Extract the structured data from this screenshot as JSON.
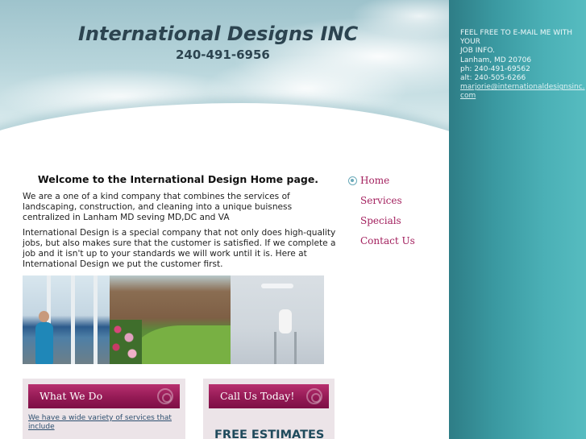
{
  "header": {
    "title": "International Designs INC",
    "phone": "240-491-6956"
  },
  "contact": {
    "line1": "FEEL FREE TO E-MAIL ME WITH YOUR",
    "line2": "JOB INFO.",
    "address": "Lanham, MD 20706",
    "phone": "ph: 240-491-69562",
    "alt": "alt: 240-505-6266",
    "email": "marjorie@internationaldesignsinc.com"
  },
  "nav": {
    "items": [
      {
        "label": "Home"
      },
      {
        "label": "Services"
      },
      {
        "label": "Specials"
      },
      {
        "label": "Contact Us"
      }
    ]
  },
  "main": {
    "welcome": "Welcome to the International Design Home page.",
    "paragraph1": "We are a one of a kind company that combines the services of landscaping, construction, and cleaning into a unique buisness centralized in Lanham MD seving MD,DC and VA",
    "paragraph2": "International Design is a special company that not only does high-quality jobs, but also makes sure that the customer is satisfied. If we complete a job and it isn't up to your standards we will work until it is. Here at International Design we put the customer first."
  },
  "boxes": {
    "what_we_do": {
      "title": "What We Do",
      "link": "We have a wide variety of services that include"
    },
    "call_us": {
      "title": "Call Us Today!",
      "text": "FREE ESTIMATES"
    }
  },
  "colors": {
    "accent": "#a3205e",
    "box_header": "#941a55",
    "teal": "#3b9aa2"
  }
}
